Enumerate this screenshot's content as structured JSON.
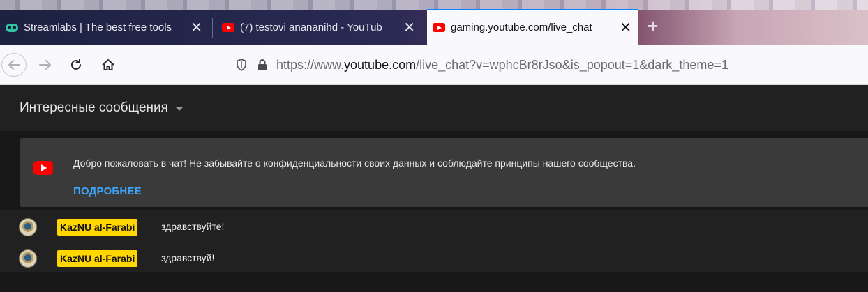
{
  "browser": {
    "tabs": [
      {
        "title": "Streamlabs | The best free tools",
        "favicon": "streamlabs-icon",
        "active": false
      },
      {
        "title": "(7) testovi anananihd - YouTub",
        "favicon": "youtube-icon",
        "active": false
      },
      {
        "title": "gaming.youtube.com/live_chat",
        "favicon": "youtube-icon",
        "active": true
      }
    ],
    "new_tab_label": "+",
    "address": {
      "prefix": "https://www.",
      "host": "youtube.com",
      "path": "/live_chat?v=wphcBr8rJso&is_popout=1&dark_theme=1"
    }
  },
  "chat": {
    "header_title": "Интересные сообщения",
    "welcome": {
      "text": "Добро пожаловать в чат! Не забывайте о конфиденциальности своих данных и соблюдайте принципы нашего сообщества.",
      "link": "ПОДРОБНЕЕ"
    },
    "messages": [
      {
        "author": "KazNU al-Farabi",
        "text": "здравствуйте!"
      },
      {
        "author": "KazNU al-Farabi",
        "text": "здравствуй!"
      }
    ]
  },
  "colors": {
    "accent_blue": "#3ea6ff",
    "owner_badge": "#ffd600",
    "youtube_red": "#ff0000",
    "chat_bg": "#212121",
    "banner_bg": "#3a3a3a"
  }
}
